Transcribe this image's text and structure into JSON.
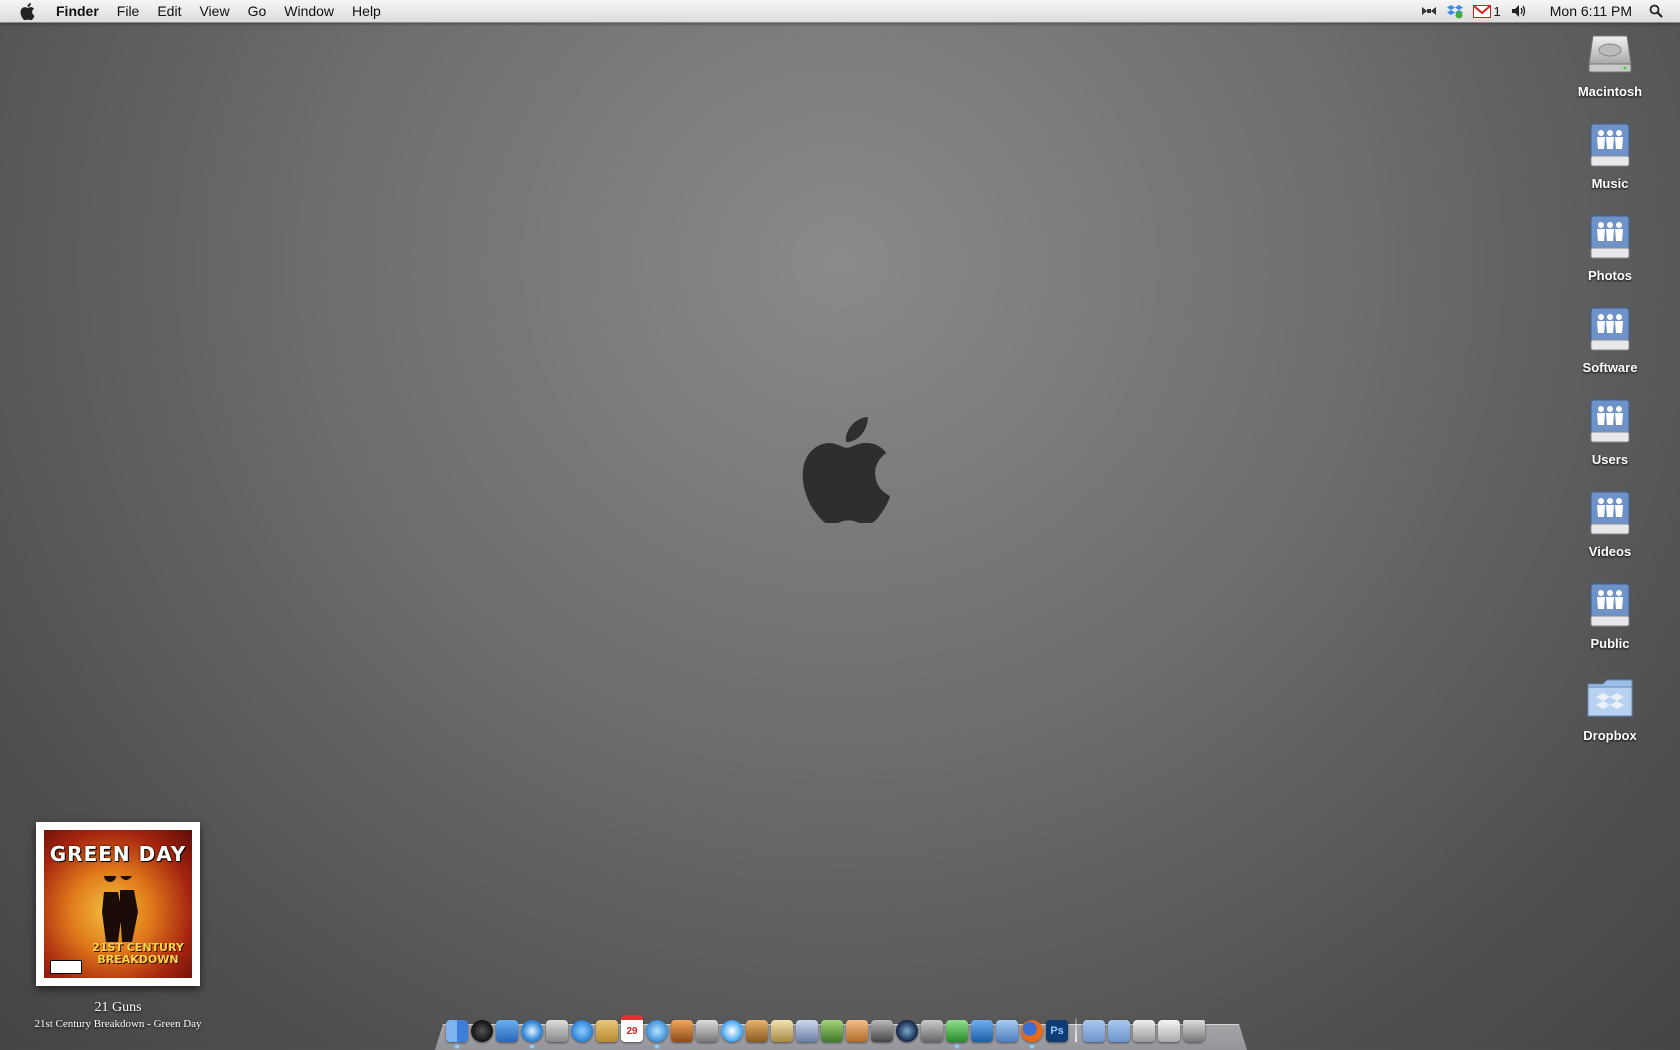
{
  "menubar": {
    "app_name": "Finder",
    "menus": [
      "File",
      "Edit",
      "View",
      "Go",
      "Window",
      "Help"
    ],
    "mail_unread": "1",
    "clock": "Mon 6:11 PM"
  },
  "desktop": {
    "icons": [
      {
        "label": "Macintosh",
        "icon": "hard-drive-icon"
      },
      {
        "label": "Music",
        "icon": "network-share-icon"
      },
      {
        "label": "Photos",
        "icon": "network-share-icon"
      },
      {
        "label": "Software",
        "icon": "network-share-icon"
      },
      {
        "label": "Users",
        "icon": "network-share-icon"
      },
      {
        "label": "Videos",
        "icon": "network-share-icon"
      },
      {
        "label": "Public",
        "icon": "network-share-icon"
      },
      {
        "label": "Dropbox",
        "icon": "dropbox-folder-icon"
      }
    ]
  },
  "now_playing": {
    "album_band": "GREEN DAY",
    "album_subtitle": "21ST CENTURY BREAKDOWN",
    "track": "21 Guns",
    "album_artist": "21st Century Breakdown - Green Day"
  },
  "dock": {
    "calendar_day": "29",
    "photoshop_label": "Ps",
    "colors": {
      "finder": "#3d7fd8",
      "dashboard": "#333333",
      "safari": "#2f86d6",
      "firefox": "#e76a1c",
      "photoshop": "#0f3d73",
      "folder": "#7fa6d8"
    }
  }
}
